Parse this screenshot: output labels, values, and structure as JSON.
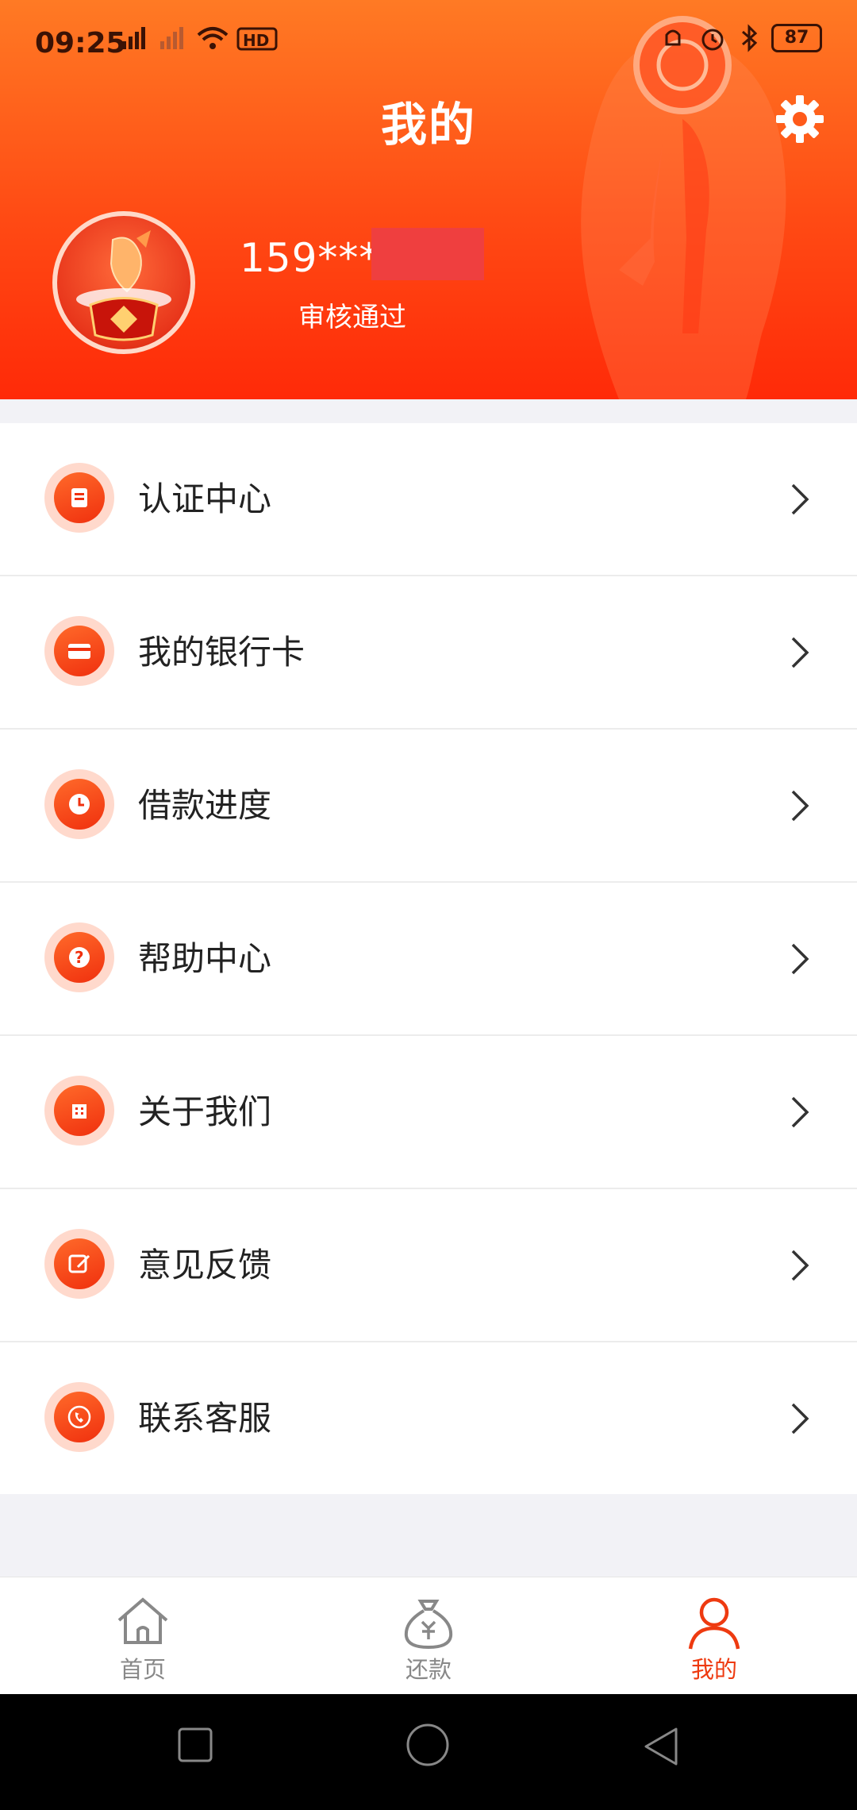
{
  "status_bar": {
    "time": "09:25",
    "battery": "87"
  },
  "header": {
    "title": "我的",
    "phone": "159****",
    "verify_status": "审核通过"
  },
  "menu": [
    {
      "label": "认证中心",
      "icon": "certificate-icon"
    },
    {
      "label": "我的银行卡",
      "icon": "bank-card-icon"
    },
    {
      "label": "借款进度",
      "icon": "clock-icon"
    },
    {
      "label": "帮助中心",
      "icon": "question-icon"
    },
    {
      "label": "关于我们",
      "icon": "building-icon"
    },
    {
      "label": "意见反馈",
      "icon": "edit-icon"
    },
    {
      "label": "联系客服",
      "icon": "phone-icon"
    }
  ],
  "tabs": [
    {
      "label": "首页",
      "icon": "home-icon",
      "active": false
    },
    {
      "label": "还款",
      "icon": "money-bag-icon",
      "active": false
    },
    {
      "label": "我的",
      "icon": "user-icon",
      "active": true
    }
  ],
  "colors": {
    "accent": "#ee3a10",
    "header_top": "#ff7a24",
    "header_bottom": "#ff2a08"
  }
}
